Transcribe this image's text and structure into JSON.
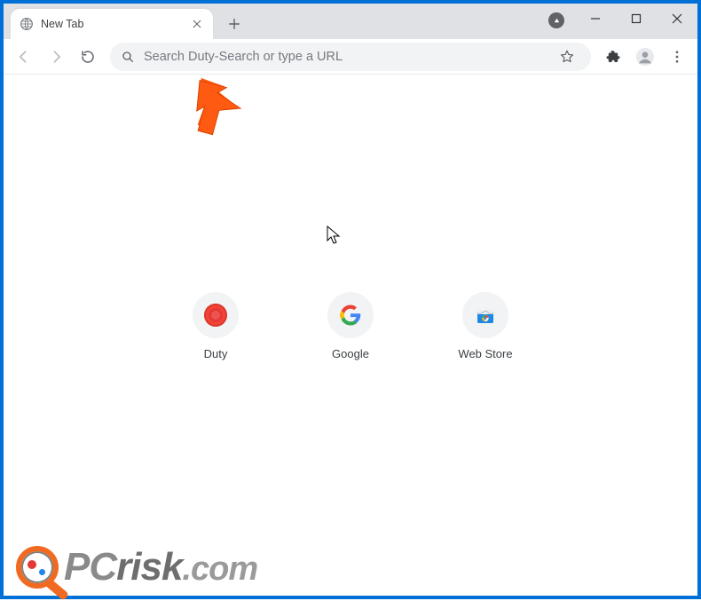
{
  "window": {
    "tab_title": "New Tab"
  },
  "toolbar": {
    "search_placeholder": "Search Duty-Search or type a URL"
  },
  "shortcuts": [
    {
      "label": "Duty"
    },
    {
      "label": "Google"
    },
    {
      "label": "Web Store"
    }
  ],
  "watermark": {
    "brand_pc": "PC",
    "brand_risk": "risk",
    "brand_tld": ".com"
  }
}
